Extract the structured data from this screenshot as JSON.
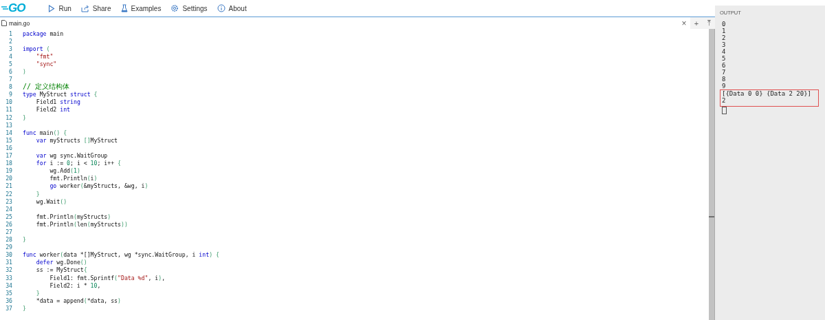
{
  "header": {
    "logo": "GO",
    "actions": [
      {
        "label": "Run"
      },
      {
        "label": "Share"
      },
      {
        "label": "Examples"
      },
      {
        "label": "Settings"
      },
      {
        "label": "About"
      }
    ]
  },
  "editor": {
    "tab": {
      "label": "main.go",
      "selected": true
    },
    "close": "×",
    "add": "+",
    "pin": "⤒",
    "lines": [
      {
        "number": "1",
        "tokens": [
          {
            "text": "package",
            "kind": "k"
          },
          {
            "text": " main"
          }
        ]
      },
      {
        "number": "2"
      },
      {
        "number": "3",
        "tokens": [
          {
            "text": "import ",
            "kind": "k"
          },
          {
            "text": "(",
            "kind": "p"
          }
        ]
      },
      {
        "number": "4",
        "tokens": [
          {
            "text": "    \"fmt\"",
            "kind": "s"
          }
        ]
      },
      {
        "number": "5",
        "tokens": [
          {
            "text": "    \"sync\"",
            "kind": "s"
          }
        ]
      },
      {
        "number": "6",
        "tokens": [
          {
            "text": ")",
            "kind": "p"
          }
        ]
      },
      {
        "number": "7"
      },
      {
        "number": "8",
        "tokens": [
          {
            "text": "// 定义结构体",
            "kind": "c"
          }
        ]
      },
      {
        "number": "9",
        "tokens": [
          {
            "text": "type",
            "kind": "k"
          },
          {
            "text": " MyStruct "
          },
          {
            "text": "struct",
            "kind": "k"
          },
          {
            "text": " {",
            "kind": "p"
          }
        ]
      },
      {
        "number": "10",
        "tokens": [
          {
            "text": "    Field1 "
          },
          {
            "text": "string",
            "kind": "k"
          }
        ]
      },
      {
        "number": "11",
        "tokens": [
          {
            "text": "    Field2 "
          },
          {
            "text": "int",
            "kind": "k"
          }
        ]
      },
      {
        "number": "12",
        "tokens": [
          {
            "text": "}",
            "kind": "p"
          }
        ]
      },
      {
        "number": "13"
      },
      {
        "number": "14",
        "tokens": [
          {
            "text": "func",
            "kind": "k"
          },
          {
            "text": " main"
          },
          {
            "text": "() {",
            "kind": "p"
          }
        ]
      },
      {
        "number": "15",
        "tokens": [
          {
            "text": "    var",
            "kind": "k"
          },
          {
            "text": " myStructs "
          },
          {
            "text": "[]",
            "kind": "p"
          },
          {
            "text": "MyStruct"
          }
        ]
      },
      {
        "number": "16"
      },
      {
        "number": "17",
        "tokens": [
          {
            "text": "    var",
            "kind": "k"
          },
          {
            "text": " wg sync.WaitGroup"
          }
        ]
      },
      {
        "number": "18",
        "tokens": [
          {
            "text": "    for",
            "kind": "k"
          },
          {
            "text": " i := "
          },
          {
            "text": "0",
            "kind": "n"
          },
          {
            "text": "; i < "
          },
          {
            "text": "10",
            "kind": "n"
          },
          {
            "text": "; i++ "
          },
          {
            "text": "{",
            "kind": "p"
          }
        ]
      },
      {
        "number": "19",
        "tokens": [
          {
            "text": "        wg.Add"
          },
          {
            "text": "(",
            "kind": "p"
          },
          {
            "text": "1",
            "kind": "n"
          },
          {
            "text": ")",
            "kind": "p"
          }
        ]
      },
      {
        "number": "20",
        "tokens": [
          {
            "text": "        fmt.Println"
          },
          {
            "text": "(",
            "kind": "p"
          },
          {
            "text": "i"
          },
          {
            "text": ")",
            "kind": "p"
          }
        ]
      },
      {
        "number": "21",
        "tokens": [
          {
            "text": "        go",
            "kind": "k"
          },
          {
            "text": " worker"
          },
          {
            "text": "(",
            "kind": "p"
          },
          {
            "text": "&myStructs, &wg, i"
          },
          {
            "text": ")",
            "kind": "p"
          }
        ]
      },
      {
        "number": "22",
        "tokens": [
          {
            "text": "    }",
            "kind": "p"
          }
        ]
      },
      {
        "number": "23",
        "tokens": [
          {
            "text": "    wg.Wait"
          },
          {
            "text": "()",
            "kind": "p"
          }
        ]
      },
      {
        "number": "24"
      },
      {
        "number": "25",
        "tokens": [
          {
            "text": "    fmt.Println"
          },
          {
            "text": "(",
            "kind": "p"
          },
          {
            "text": "myStructs"
          },
          {
            "text": ")",
            "kind": "p"
          }
        ]
      },
      {
        "number": "26",
        "tokens": [
          {
            "text": "    fmt.Println"
          },
          {
            "text": "(",
            "kind": "p"
          },
          {
            "text": "len"
          },
          {
            "text": "(",
            "kind": "p"
          },
          {
            "text": "myStructs"
          },
          {
            "text": "))",
            "kind": "p"
          }
        ]
      },
      {
        "number": "27"
      },
      {
        "number": "28",
        "tokens": [
          {
            "text": "}",
            "kind": "p"
          }
        ]
      },
      {
        "number": "29"
      },
      {
        "number": "30",
        "tokens": [
          {
            "text": "func",
            "kind": "k"
          },
          {
            "text": " worker"
          },
          {
            "text": "(",
            "kind": "p"
          },
          {
            "text": "data *[]MyStruct, wg *sync.WaitGroup, i "
          },
          {
            "text": "int",
            "kind": "k"
          },
          {
            "text": ") {",
            "kind": "p"
          }
        ]
      },
      {
        "number": "31",
        "tokens": [
          {
            "text": "    defer",
            "kind": "k"
          },
          {
            "text": " wg.Done"
          },
          {
            "text": "()",
            "kind": "p"
          }
        ]
      },
      {
        "number": "32",
        "tokens": [
          {
            "text": "    ss := MyStruct"
          },
          {
            "text": "{",
            "kind": "p"
          }
        ]
      },
      {
        "number": "33",
        "tokens": [
          {
            "text": "        Field1: fmt.Sprintf"
          },
          {
            "text": "(",
            "kind": "p"
          },
          {
            "text": "\"Data %d\"",
            "kind": "s"
          },
          {
            "text": ", i"
          },
          {
            "text": ")",
            "kind": "p"
          },
          {
            "text": ","
          }
        ]
      },
      {
        "number": "34",
        "tokens": [
          {
            "text": "        Field2: i * "
          },
          {
            "text": "10",
            "kind": "n"
          },
          {
            "text": ","
          }
        ]
      },
      {
        "number": "35",
        "tokens": [
          {
            "text": "    }",
            "kind": "p"
          }
        ]
      },
      {
        "number": "36",
        "tokens": [
          {
            "text": "    *data = append"
          },
          {
            "text": "(",
            "kind": "p"
          },
          {
            "text": "*data, ss"
          },
          {
            "text": ")",
            "kind": "p"
          }
        ]
      },
      {
        "number": "37",
        "tokens": [
          {
            "text": "}",
            "kind": "p"
          }
        ]
      }
    ]
  },
  "output": {
    "title": "OUTPUT",
    "lines": [
      {
        "text": "0",
        "highlighted": false
      },
      {
        "text": "1",
        "highlighted": false
      },
      {
        "text": "2",
        "highlighted": false
      },
      {
        "text": "3",
        "highlighted": false
      },
      {
        "text": "4",
        "highlighted": false
      },
      {
        "text": "5",
        "highlighted": false
      },
      {
        "text": "6",
        "highlighted": false
      },
      {
        "text": "7",
        "highlighted": false
      },
      {
        "text": "8",
        "highlighted": false
      },
      {
        "text": "9",
        "highlighted": false
      },
      {
        "text": "[{Data 0 0} {Data 2 20}]",
        "highlighted": true
      },
      {
        "text": "2",
        "highlighted": true
      }
    ]
  }
}
